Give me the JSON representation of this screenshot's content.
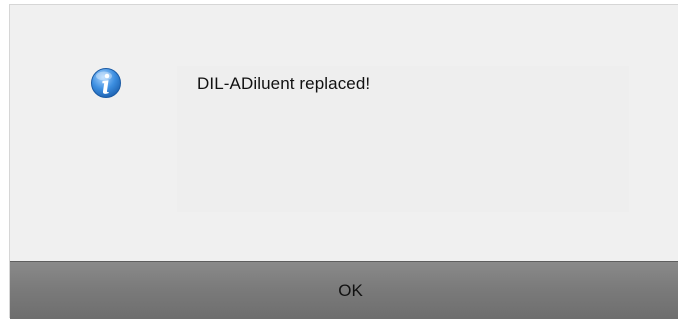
{
  "dialog": {
    "icon": "info-icon",
    "message": "DIL-ADiluent replaced!",
    "ok_label": "OK"
  },
  "colors": {
    "dialog_bg": "#f0f0f0",
    "button_bar": "#7b7b7b",
    "icon_blue": "#2f7fd0"
  }
}
